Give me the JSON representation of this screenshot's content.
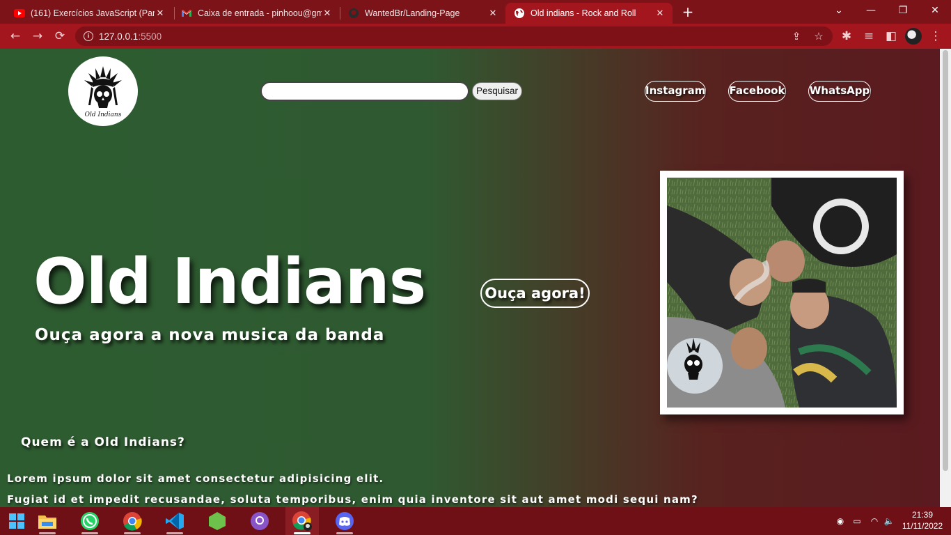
{
  "browser": {
    "tabs": [
      {
        "title": "(161) Exercícios JavaScript (Parte",
        "icon": "youtube-icon"
      },
      {
        "title": "Caixa de entrada - pinhoou@gm",
        "icon": "gmail-icon"
      },
      {
        "title": "WantedBr/Landing-Page",
        "icon": "github-icon"
      },
      {
        "title": "Old indians - Rock and Roll",
        "icon": "globe-icon",
        "active": true
      }
    ],
    "url_host": "127.0.0.1",
    "url_port": ":5500"
  },
  "page": {
    "search": {
      "placeholder": "",
      "button": "Pesquisar"
    },
    "social": [
      "Instagram",
      "Facebook",
      "WhatsApp"
    ],
    "hero": {
      "title": "Old Indians",
      "subtitle": "Ouça agora a nova musica da banda",
      "cta": "Ouça agora!"
    },
    "about": {
      "title": "Quem é a Old Indians?",
      "line1": "Lorem ipsum dolor sit amet consectetur adipisicing elit.",
      "line2": "Fugiat id et impedit recusandae, soluta temporibus, enim quia inventore sit aut amet modi sequi nam?"
    }
  },
  "taskbar": {
    "apps": [
      "start-icon",
      "file-explorer-icon",
      "whatsapp-icon",
      "chrome-icon",
      "vscode-icon",
      "nodejs-icon",
      "github-desktop-icon",
      "chrome-profile-icon",
      "discord-icon"
    ],
    "time": "21:39",
    "date": "11/11/2022"
  },
  "colors": {
    "chrome_frame": "#7c1319",
    "chrome_toolbar": "#a4161e",
    "page_green": "#2e5c31",
    "page_maroon": "#5a1a1f"
  }
}
